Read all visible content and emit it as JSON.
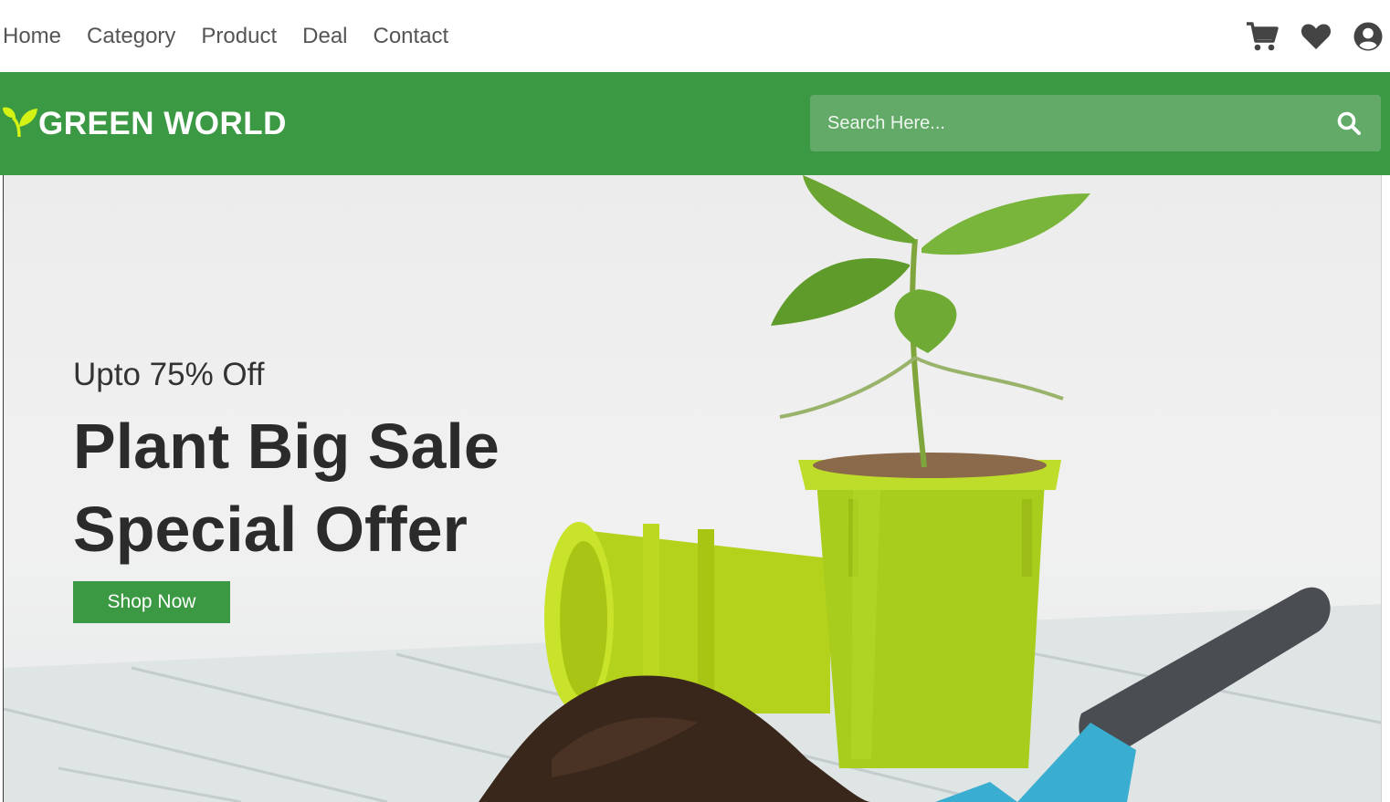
{
  "nav": {
    "links": [
      "Home",
      "Category",
      "Product",
      "Deal",
      "Contact"
    ],
    "icons": [
      "cart-icon",
      "heart-icon",
      "user-icon"
    ]
  },
  "brand": {
    "name": "GREEN WORLD",
    "logo_icon": "sprout-icon",
    "color": "#3a9942",
    "accent": "#d4f214"
  },
  "search": {
    "placeholder": "Search Here...",
    "icon": "search-icon"
  },
  "hero": {
    "subtitle": "Upto 75% Off",
    "title_line1": "Plant Big Sale",
    "title_line2": "Special Offer",
    "button_label": "Shop Now"
  }
}
